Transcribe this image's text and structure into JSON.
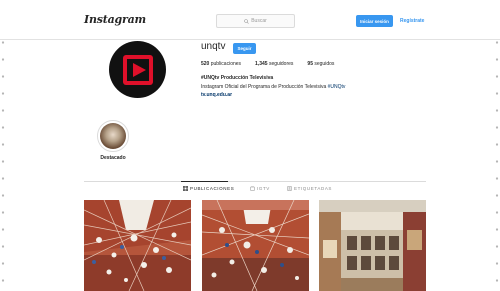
{
  "header": {
    "logo": "Instagram",
    "search_placeholder": "Buscar",
    "login_label": "Iniciar sesión",
    "register_label": "Regístrate"
  },
  "profile": {
    "username": "unqtv",
    "follow_label": "Seguir",
    "stats": {
      "posts_count": "520",
      "posts_label": "publicaciones",
      "followers_count": "1,345",
      "followers_label": "seguidores",
      "following_count": "95",
      "following_label": "seguidos"
    },
    "full_name": "#UNQtv Producción Televisiva",
    "bio_text": "Instagram Oficial del Programa de Producción Televisiva ",
    "bio_hashtag": "#UNQtv",
    "website": "tv.unq.edu.ar"
  },
  "highlights": [
    {
      "label": "Destacado"
    }
  ],
  "tabs": [
    {
      "label": "PUBLICACIONES",
      "icon": "grid-icon",
      "active": true
    },
    {
      "label": "IGTV",
      "icon": "tv-icon",
      "active": false
    },
    {
      "label": "ETIQUETADAS",
      "icon": "tag-icon",
      "active": false
    }
  ],
  "colors": {
    "primary_button": "#3897f0",
    "logo_red": "#e0102a",
    "text": "#262626",
    "link": "#003569"
  }
}
